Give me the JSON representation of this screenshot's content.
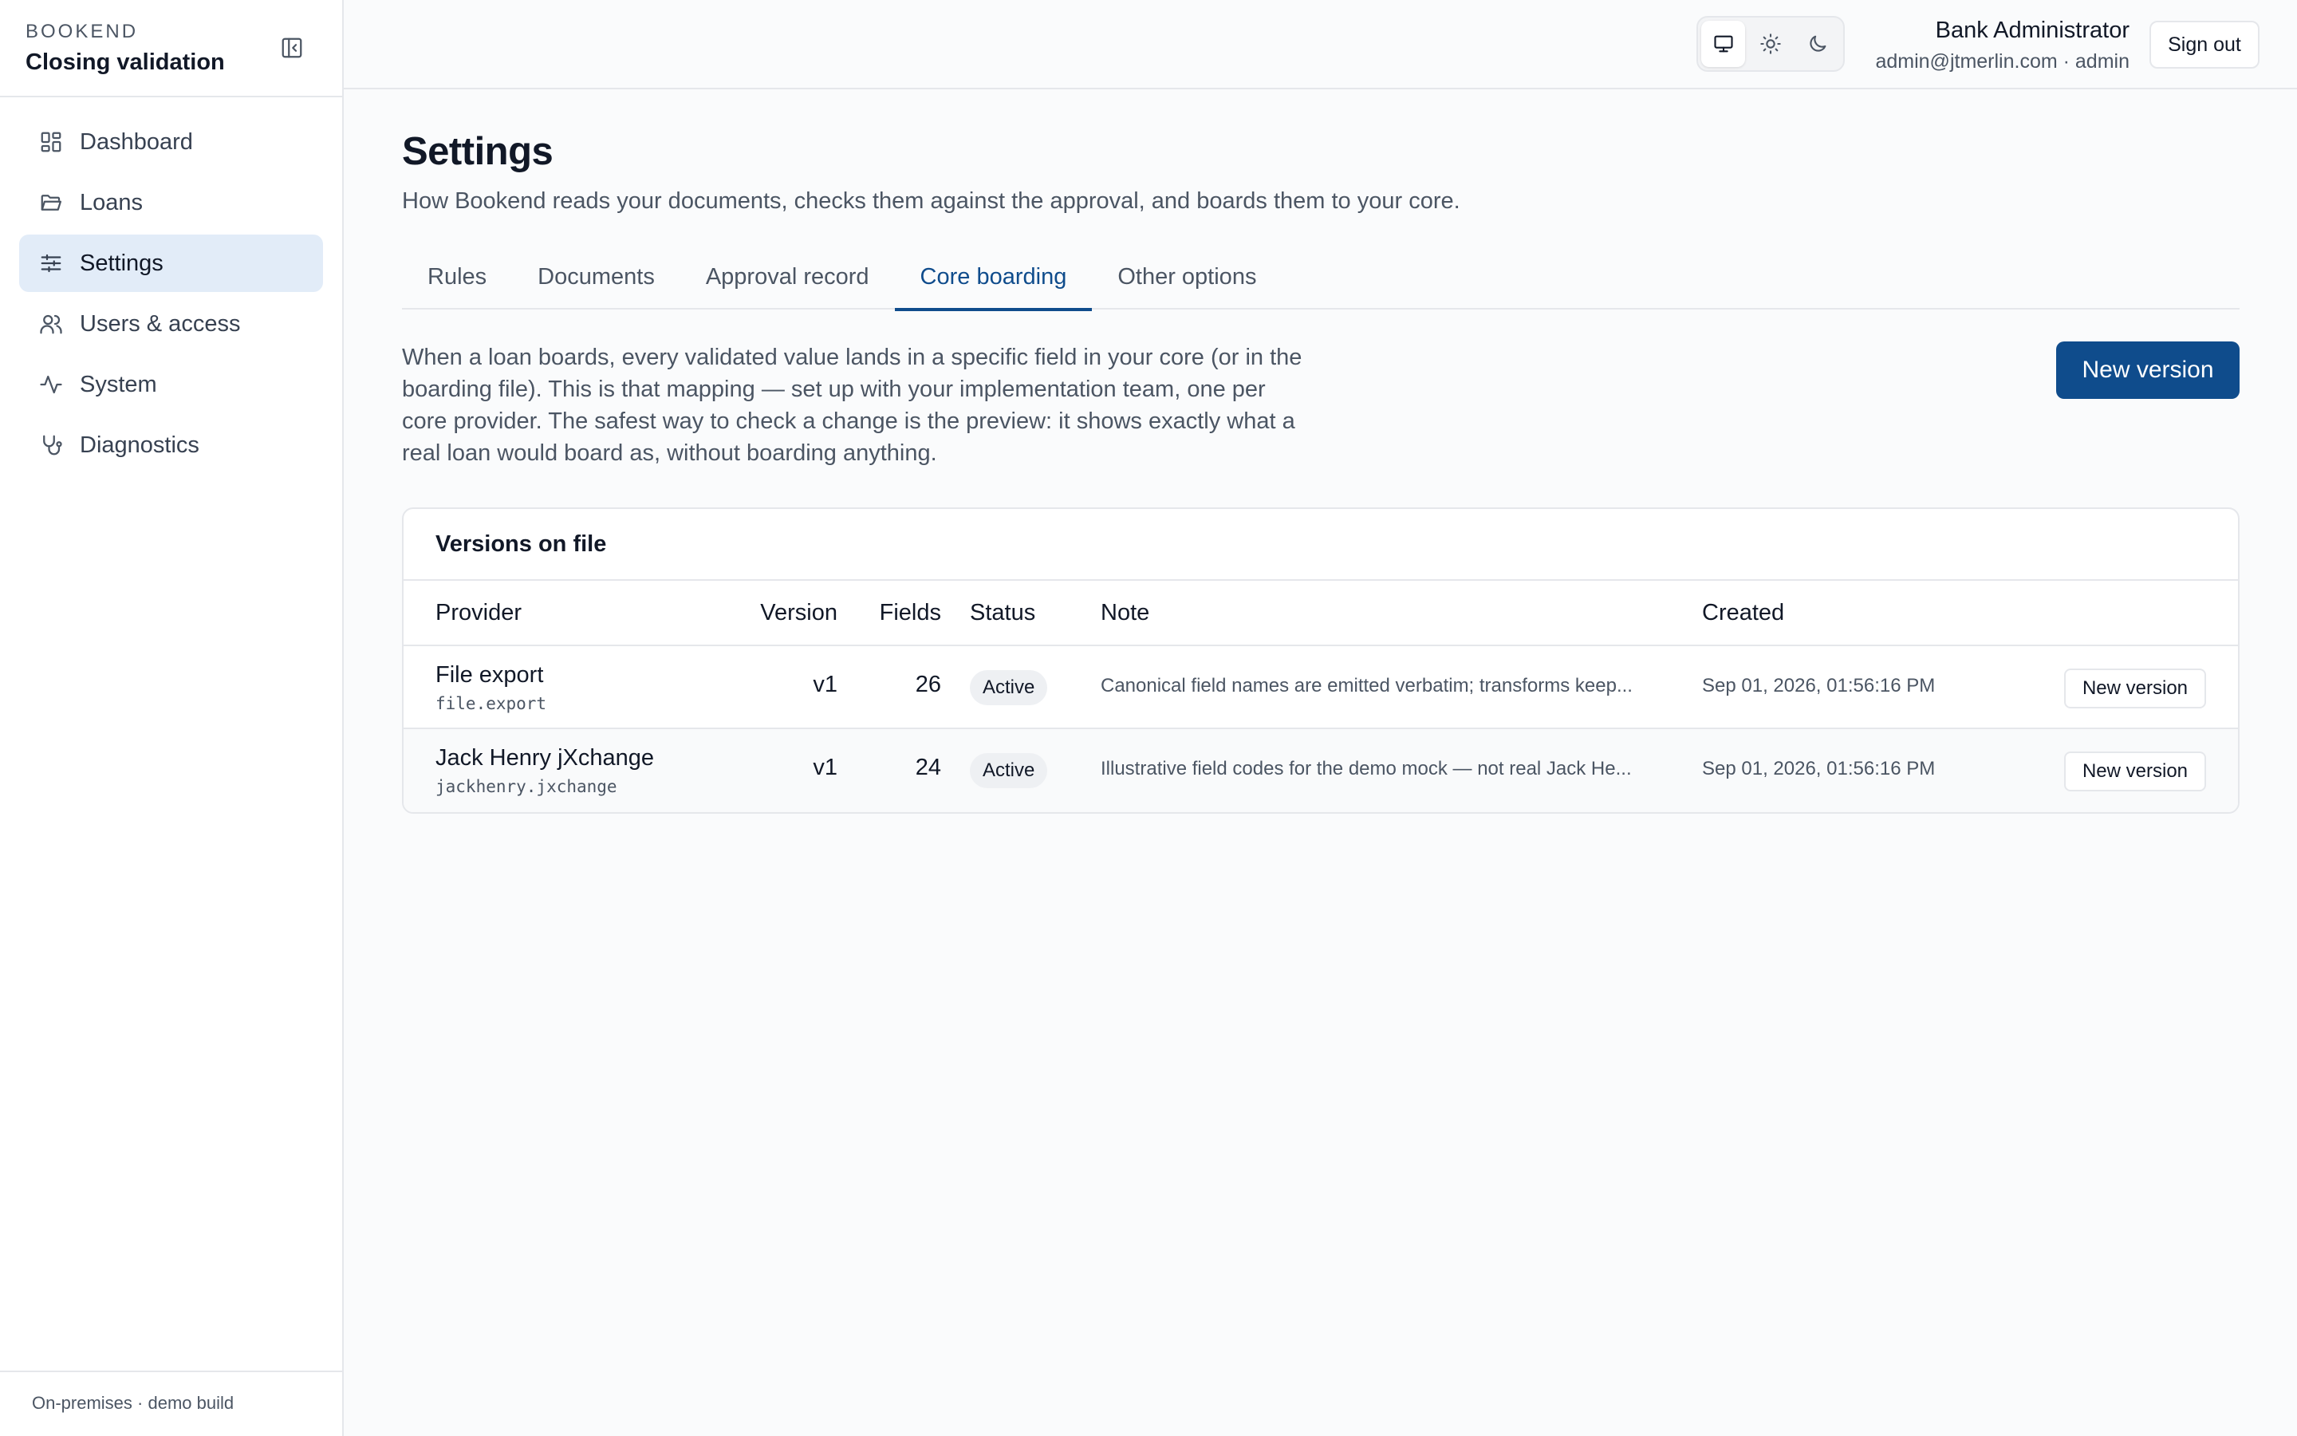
{
  "brand": {
    "name": "BOOKEND",
    "subtitle": "Closing validation"
  },
  "sidebar": {
    "items": [
      {
        "label": "Dashboard",
        "icon": "grid-icon"
      },
      {
        "label": "Loans",
        "icon": "folder-icon"
      },
      {
        "label": "Settings",
        "icon": "sliders-icon",
        "active": true
      },
      {
        "label": "Users & access",
        "icon": "users-icon"
      },
      {
        "label": "System",
        "icon": "activity-icon"
      },
      {
        "label": "Diagnostics",
        "icon": "stethoscope-icon"
      }
    ],
    "footer": "On-premises · demo build"
  },
  "header": {
    "theme_options": [
      "monitor-icon",
      "sun-icon",
      "moon-icon"
    ],
    "theme_selected": "monitor-icon",
    "user_name": "Bank Administrator",
    "user_email": "admin@jtmerlin.com · admin",
    "sign_out": "Sign out"
  },
  "page": {
    "title": "Settings",
    "description": "How Bookend reads your documents, checks them against the approval, and boards them to your core.",
    "tabs": [
      "Rules",
      "Documents",
      "Approval record",
      "Core boarding",
      "Other options"
    ],
    "active_tab": "Core boarding",
    "intro": "When a loan boards, every validated value lands in a specific field in your core (or in the boarding file). This is that mapping — set up with your implementation team, one per core provider. The safest way to check a change is the preview: it shows exactly what a real loan would board as, without boarding anything.",
    "new_version_button": "New version"
  },
  "versions": {
    "title": "Versions on file",
    "columns": [
      "Provider",
      "Version",
      "Fields",
      "Status",
      "Note",
      "Created"
    ],
    "rows": [
      {
        "provider": "File export",
        "code": "file.export",
        "version": "v1",
        "fields": "26",
        "status": "Active",
        "note": "Canonical field names are emitted verbatim; transforms keep...",
        "created": "Sep 01, 2026, 01:56:16 PM",
        "action": "New version"
      },
      {
        "provider": "Jack Henry jXchange",
        "code": "jackhenry.jxchange",
        "version": "v1",
        "fields": "24",
        "status": "Active",
        "note": "Illustrative field codes for the demo mock — not real Jack He...",
        "created": "Sep 01, 2026, 01:56:16 PM",
        "action": "New version"
      }
    ]
  },
  "colors": {
    "accent": "#0f4c8c",
    "active_nav_bg": "#e2ecf8"
  }
}
